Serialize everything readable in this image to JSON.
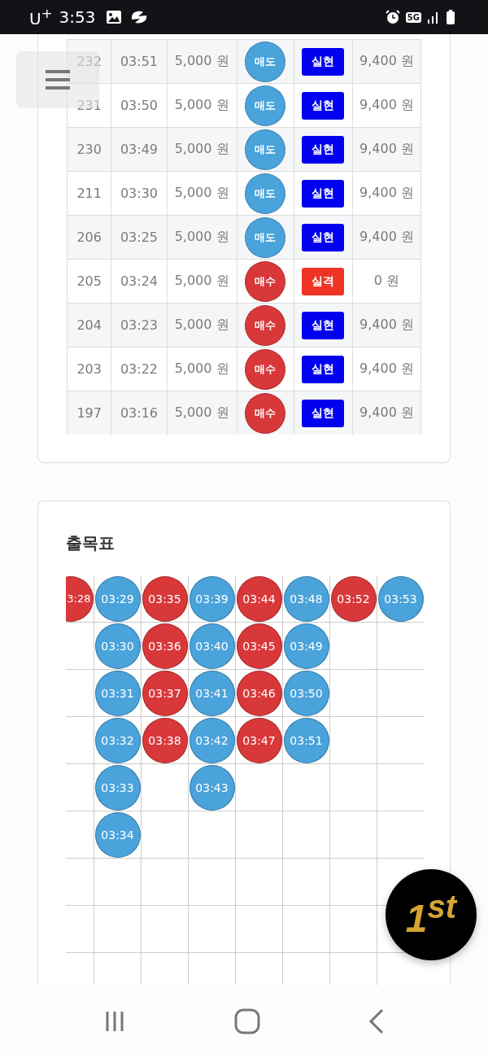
{
  "status_bar": {
    "carrier": "U$^{+}$",
    "time": "3:53",
    "network": "5G"
  },
  "bets": {
    "rows": [
      {
        "id": "232",
        "time": "03:51",
        "amount": "5,000 원",
        "side": {
          "label": "매도",
          "color": "#4aa3db"
        },
        "result": {
          "label": "실현",
          "color": "#0000ee"
        },
        "payout": "9,400 원"
      },
      {
        "id": "231",
        "time": "03:50",
        "amount": "5,000 원",
        "side": {
          "label": "매도",
          "color": "#4aa3db"
        },
        "result": {
          "label": "실현",
          "color": "#0000ee"
        },
        "payout": "9,400 원"
      },
      {
        "id": "230",
        "time": "03:49",
        "amount": "5,000 원",
        "side": {
          "label": "매도",
          "color": "#4aa3db"
        },
        "result": {
          "label": "실현",
          "color": "#0000ee"
        },
        "payout": "9,400 원"
      },
      {
        "id": "211",
        "time": "03:30",
        "amount": "5,000 원",
        "side": {
          "label": "매도",
          "color": "#4aa3db"
        },
        "result": {
          "label": "실현",
          "color": "#0000ee"
        },
        "payout": "9,400 원"
      },
      {
        "id": "206",
        "time": "03:25",
        "amount": "5,000 원",
        "side": {
          "label": "매도",
          "color": "#4aa3db"
        },
        "result": {
          "label": "실현",
          "color": "#0000ee"
        },
        "payout": "9,400 원"
      },
      {
        "id": "205",
        "time": "03:24",
        "amount": "5,000 원",
        "side": {
          "label": "매수",
          "color": "#d9383a"
        },
        "result": {
          "label": "실격",
          "color": "#ee3324"
        },
        "payout": "0 원"
      },
      {
        "id": "204",
        "time": "03:23",
        "amount": "5,000 원",
        "side": {
          "label": "매수",
          "color": "#d9383a"
        },
        "result": {
          "label": "실현",
          "color": "#0000ee"
        },
        "payout": "9,400 원"
      },
      {
        "id": "203",
        "time": "03:22",
        "amount": "5,000 원",
        "side": {
          "label": "매수",
          "color": "#d9383a"
        },
        "result": {
          "label": "실현",
          "color": "#0000ee"
        },
        "payout": "9,400 원"
      },
      {
        "id": "197",
        "time": "03:16",
        "amount": "5,000 원",
        "side": {
          "label": "매수",
          "color": "#d9383a"
        },
        "result": {
          "label": "실현",
          "color": "#0000ee"
        },
        "payout": "9,400 원"
      }
    ]
  },
  "grid": {
    "title": "출목표",
    "columns": [
      {
        "color": "#d9383a",
        "cells": [
          "3:28"
        ]
      },
      {
        "color": "#4aa3db",
        "cells": [
          "03:29",
          "03:30",
          "03:31",
          "03:32",
          "03:33",
          "03:34"
        ]
      },
      {
        "color": "#d9383a",
        "cells": [
          "03:35",
          "03:36",
          "03:37",
          "03:38"
        ]
      },
      {
        "color": "#4aa3db",
        "cells": [
          "03:39",
          "03:40",
          "03:41",
          "03:42",
          "03:43"
        ]
      },
      {
        "color": "#d9383a",
        "cells": [
          "03:44",
          "03:45",
          "03:46",
          "03:47"
        ]
      },
      {
        "color": "#4aa3db",
        "cells": [
          "03:48",
          "03:49",
          "03:50",
          "03:51"
        ]
      },
      {
        "color": "#d9383a",
        "cells": [
          "03:52"
        ]
      },
      {
        "color": "#4aa3db",
        "cells": [
          "03:53"
        ]
      }
    ]
  },
  "badge": {
    "label": "1$^{st}$"
  }
}
